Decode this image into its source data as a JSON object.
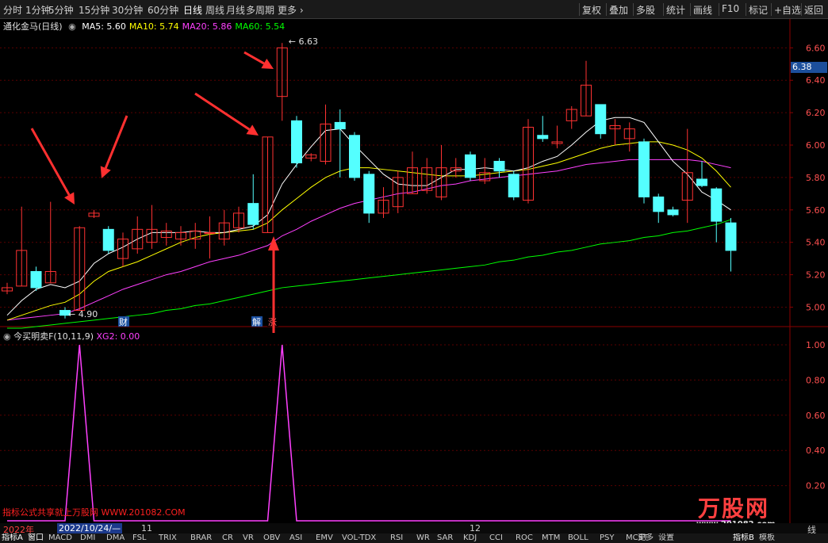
{
  "toolbar": {
    "left": [
      "分时",
      "1分钟",
      "5分钟",
      "15分钟",
      "30分钟",
      "60分钟",
      "日线",
      "周线",
      "月线",
      "多周期",
      "更多"
    ],
    "right": [
      "复权",
      "叠加",
      "多股",
      "统计",
      "画线",
      "F10",
      "标记",
      "+自选",
      "返回"
    ],
    "active": "日线"
  },
  "header": {
    "stock": "通化金马(日线)",
    "ma": [
      {
        "label": "MA5: 5.60",
        "color": "#ffffff"
      },
      {
        "label": "MA10: 5.74",
        "color": "#ffff00"
      },
      {
        "label": "MA20: 5.86",
        "color": "#ff40ff"
      },
      {
        "label": "MA60: 5.54",
        "color": "#00ff00"
      }
    ]
  },
  "price_axis": {
    "labels": [
      "6.60",
      "6.40",
      "6.20",
      "6.00",
      "5.80",
      "5.60",
      "5.40",
      "5.20",
      "5.00"
    ],
    "current": "6.38",
    "high_note": "6.63",
    "low_note": "4.90"
  },
  "markers": {
    "cai": "财",
    "jie": "解",
    "zhang": "涨"
  },
  "indicator": {
    "name": "今买明卖F(10,11,9)",
    "xg2": "XG2: 0.00",
    "axis": [
      "1.00",
      "0.80",
      "0.60",
      "0.40",
      "0.20"
    ]
  },
  "watermark": "指标公式共享就上万股网 WWW.201082.COM",
  "brand": {
    "name": "万股网",
    "url": "www.201082.com"
  },
  "dates": {
    "year": "2022年",
    "cursor": "2022/10/24/—",
    "m11": "11",
    "m12": "12",
    "right": "线"
  },
  "bottom_tabs": [
    "指标A",
    "窗口",
    "MACD",
    "DMI",
    "DMA",
    "FSL",
    "TRIX",
    "BRAR",
    "CR",
    "VR",
    "OBV",
    "ASI",
    "EMV",
    "VOL-TDX",
    "RSI",
    "WR",
    "SAR",
    "KDJ",
    "CCI",
    "ROC",
    "MTM",
    "BOLL",
    "PSY",
    "MCST",
    "更多",
    "设置",
    "指标B",
    "模板"
  ],
  "colors": {
    "up": "#ff3232",
    "down": "#54ffff",
    "ma5": "#ffffff",
    "ma10": "#ffff00",
    "ma20": "#ff40ff",
    "ma60": "#00ff00",
    "signal": "#ff40ff",
    "arrow": "#ff3030"
  },
  "chart_data": {
    "type": "candlestick",
    "ylim": [
      4.88,
      6.68
    ],
    "candles": [
      {
        "o": 5.1,
        "c": 5.12,
        "h": 5.15,
        "l": 5.08
      },
      {
        "o": 5.13,
        "c": 5.35,
        "h": 5.62,
        "l": 5.13
      },
      {
        "o": 5.22,
        "c": 5.12,
        "h": 5.25,
        "l": 5.1
      },
      {
        "o": 5.15,
        "c": 5.22,
        "h": 5.65,
        "l": 5.15
      },
      {
        "o": 4.98,
        "c": 4.95,
        "h": 5.0,
        "l": 4.93
      },
      {
        "o": 4.98,
        "c": 5.49,
        "h": 5.5,
        "l": 4.98
      },
      {
        "o": 5.56,
        "c": 5.58,
        "h": 5.6,
        "l": 5.55
      },
      {
        "o": 5.48,
        "c": 5.35,
        "h": 5.5,
        "l": 5.33
      },
      {
        "o": 5.3,
        "c": 5.42,
        "h": 5.46,
        "l": 5.25
      },
      {
        "o": 5.36,
        "c": 5.48,
        "h": 5.56,
        "l": 5.33
      },
      {
        "o": 5.4,
        "c": 5.48,
        "h": 5.63,
        "l": 5.36
      },
      {
        "o": 5.43,
        "c": 5.47,
        "h": 5.52,
        "l": 5.38
      },
      {
        "o": 5.42,
        "c": 5.46,
        "h": 5.5,
        "l": 5.38
      },
      {
        "o": 5.42,
        "c": 5.47,
        "h": 5.52,
        "l": 5.36
      },
      {
        "o": 5.46,
        "c": 5.46,
        "h": 5.56,
        "l": 5.3
      },
      {
        "o": 5.42,
        "c": 5.52,
        "h": 5.6,
        "l": 5.38
      },
      {
        "o": 5.49,
        "c": 5.58,
        "h": 5.62,
        "l": 5.46
      },
      {
        "o": 5.64,
        "c": 5.51,
        "h": 5.82,
        "l": 5.48
      },
      {
        "o": 5.46,
        "c": 6.05,
        "h": 6.05,
        "l": 5.46
      },
      {
        "o": 6.3,
        "c": 6.6,
        "h": 6.63,
        "l": 6.15
      },
      {
        "o": 6.15,
        "c": 5.89,
        "h": 6.18,
        "l": 5.86
      },
      {
        "o": 5.92,
        "c": 5.94,
        "h": 5.95,
        "l": 5.9
      },
      {
        "o": 5.9,
        "c": 6.13,
        "h": 6.25,
        "l": 5.88
      },
      {
        "o": 6.14,
        "c": 6.1,
        "h": 6.22,
        "l": 5.8
      },
      {
        "o": 6.06,
        "c": 5.8,
        "h": 6.08,
        "l": 5.78
      },
      {
        "o": 5.82,
        "c": 5.58,
        "h": 5.84,
        "l": 5.52
      },
      {
        "o": 5.58,
        "c": 5.66,
        "h": 5.74,
        "l": 5.55
      },
      {
        "o": 5.62,
        "c": 5.8,
        "h": 5.84,
        "l": 5.58
      },
      {
        "o": 5.7,
        "c": 5.86,
        "h": 5.96,
        "l": 5.7
      },
      {
        "o": 5.72,
        "c": 5.86,
        "h": 5.92,
        "l": 5.7
      },
      {
        "o": 5.68,
        "c": 5.86,
        "h": 6.0,
        "l": 5.66
      },
      {
        "o": 5.84,
        "c": 5.86,
        "h": 5.92,
        "l": 5.8
      },
      {
        "o": 5.94,
        "c": 5.8,
        "h": 5.96,
        "l": 5.78
      },
      {
        "o": 5.78,
        "c": 5.83,
        "h": 5.92,
        "l": 5.76
      },
      {
        "o": 5.9,
        "c": 5.84,
        "h": 5.92,
        "l": 5.8
      },
      {
        "o": 5.82,
        "c": 5.68,
        "h": 5.84,
        "l": 5.66
      },
      {
        "o": 5.66,
        "c": 6.11,
        "h": 6.16,
        "l": 5.64
      },
      {
        "o": 6.06,
        "c": 6.04,
        "h": 6.18,
        "l": 6.02
      },
      {
        "o": 6.01,
        "c": 6.02,
        "h": 6.12,
        "l": 5.98
      },
      {
        "o": 6.15,
        "c": 6.22,
        "h": 6.24,
        "l": 6.1
      },
      {
        "o": 6.18,
        "c": 6.37,
        "h": 6.52,
        "l": 6.18
      },
      {
        "o": 6.25,
        "c": 6.07,
        "h": 6.25,
        "l": 6.04
      },
      {
        "o": 6.1,
        "c": 6.12,
        "h": 6.16,
        "l": 6.0
      },
      {
        "o": 6.04,
        "c": 6.1,
        "h": 6.14,
        "l": 5.96
      },
      {
        "o": 6.02,
        "c": 5.68,
        "h": 6.04,
        "l": 5.64
      },
      {
        "o": 5.68,
        "c": 5.59,
        "h": 5.7,
        "l": 5.52
      },
      {
        "o": 5.6,
        "c": 5.57,
        "h": 5.62,
        "l": 5.56
      },
      {
        "o": 5.66,
        "c": 5.83,
        "h": 6.1,
        "l": 5.52
      },
      {
        "o": 5.79,
        "c": 5.75,
        "h": 5.9,
        "l": 5.74
      },
      {
        "o": 5.73,
        "c": 5.53,
        "h": 5.74,
        "l": 5.4
      },
      {
        "o": 5.52,
        "c": 5.35,
        "h": 5.55,
        "l": 5.22
      }
    ],
    "ma5": [
      4.95,
      5.04,
      5.11,
      5.14,
      5.12,
      5.16,
      5.27,
      5.33,
      5.37,
      5.42,
      5.46,
      5.46,
      5.46,
      5.47,
      5.46,
      5.46,
      5.48,
      5.5,
      5.57,
      5.76,
      5.88,
      5.99,
      6.09,
      6.1,
      6.0,
      5.91,
      5.82,
      5.76,
      5.75,
      5.75,
      5.8,
      5.85,
      5.85,
      5.86,
      5.85,
      5.84,
      5.86,
      5.9,
      5.93,
      6.0,
      6.08,
      6.15,
      6.17,
      6.17,
      6.14,
      6.02,
      5.9,
      5.82,
      5.71,
      5.66,
      5.6
    ],
    "ma10": [
      4.92,
      4.95,
      4.98,
      5.01,
      5.03,
      5.08,
      5.16,
      5.22,
      5.25,
      5.28,
      5.32,
      5.36,
      5.4,
      5.43,
      5.45,
      5.46,
      5.47,
      5.48,
      5.52,
      5.6,
      5.67,
      5.74,
      5.8,
      5.84,
      5.86,
      5.86,
      5.85,
      5.84,
      5.83,
      5.82,
      5.81,
      5.81,
      5.81,
      5.82,
      5.83,
      5.84,
      5.85,
      5.87,
      5.89,
      5.92,
      5.95,
      5.98,
      6.0,
      6.01,
      6.02,
      6.02,
      6.0,
      5.97,
      5.92,
      5.84,
      5.74
    ],
    "ma20": [
      4.92,
      4.93,
      4.94,
      4.95,
      4.96,
      4.99,
      5.03,
      5.07,
      5.11,
      5.14,
      5.17,
      5.2,
      5.22,
      5.25,
      5.28,
      5.3,
      5.32,
      5.35,
      5.38,
      5.44,
      5.48,
      5.53,
      5.57,
      5.61,
      5.64,
      5.66,
      5.68,
      5.7,
      5.71,
      5.73,
      5.75,
      5.76,
      5.78,
      5.79,
      5.8,
      5.81,
      5.82,
      5.83,
      5.84,
      5.86,
      5.88,
      5.89,
      5.9,
      5.91,
      5.91,
      5.91,
      5.91,
      5.91,
      5.9,
      5.88,
      5.86
    ],
    "ma60": [
      4.87,
      4.87,
      4.88,
      4.89,
      4.9,
      4.91,
      4.92,
      4.93,
      4.94,
      4.95,
      4.96,
      4.98,
      4.99,
      5.01,
      5.02,
      5.04,
      5.06,
      5.08,
      5.1,
      5.12,
      5.13,
      5.14,
      5.15,
      5.16,
      5.17,
      5.18,
      5.19,
      5.2,
      5.21,
      5.22,
      5.23,
      5.24,
      5.25,
      5.26,
      5.28,
      5.29,
      5.31,
      5.32,
      5.34,
      5.35,
      5.37,
      5.39,
      5.4,
      5.41,
      5.43,
      5.44,
      5.46,
      5.47,
      5.49,
      5.51,
      5.54
    ],
    "signal": {
      "spikes": [
        5,
        19
      ],
      "ylim": [
        0,
        1.0
      ]
    }
  }
}
